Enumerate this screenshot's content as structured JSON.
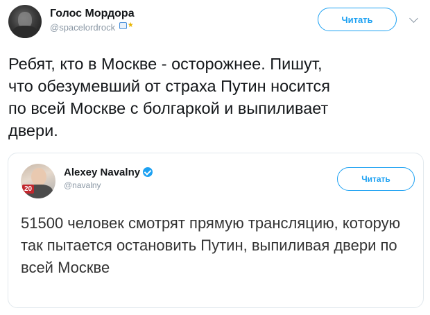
{
  "tweet": {
    "author_name": "Голос Мордора",
    "author_handle": "@spacelordrock",
    "follow_label": "Читать",
    "text": "Ребят, кто в Москве - осторожнее. Пишут,\nчто обезумевший от страха Путин носится\nпо всей Москве с болгаркой и выпиливает\nдвери."
  },
  "quoted_tweet": {
    "author_name": "Alexey Navalny",
    "author_handle": "@navalny",
    "follow_label": "Читать",
    "avatar_badge": "20",
    "text": "51500 человек смотрят прямую трансляцию, которую так пытается остановить Путин, выпиливая двери по всей Москве"
  },
  "icons": {
    "verified": "verified-check-icon",
    "menu": "chevron-down-icon"
  },
  "colors": {
    "accent": "#1da1f2",
    "text": "#14171a",
    "muted": "#8b98a5",
    "border": "#e1e8ed"
  }
}
